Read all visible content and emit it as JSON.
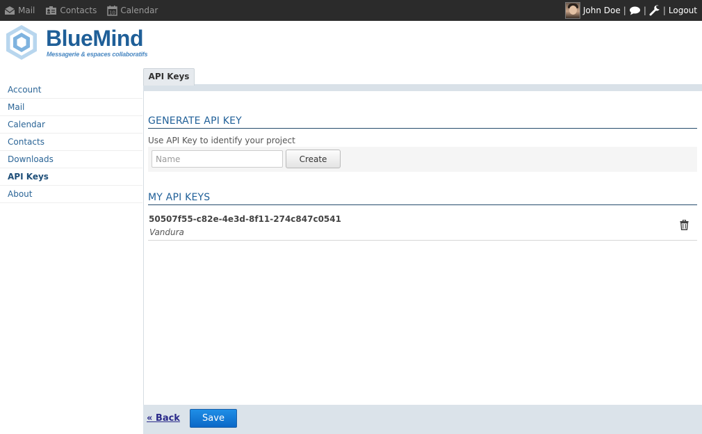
{
  "topbar": {
    "nav": [
      {
        "label": "Mail",
        "icon": "mail-icon"
      },
      {
        "label": "Contacts",
        "icon": "contacts-icon"
      },
      {
        "label": "Calendar",
        "icon": "calendar-icon"
      }
    ],
    "user_name": "John Doe",
    "separator": "|",
    "logout_label": "Logout"
  },
  "logo": {
    "title": "BlueMind",
    "subtitle": "Messagerie & espaces collaboratifs"
  },
  "sidebar": {
    "items": [
      {
        "label": "Account"
      },
      {
        "label": "Mail"
      },
      {
        "label": "Calendar"
      },
      {
        "label": "Contacts"
      },
      {
        "label": "Downloads"
      },
      {
        "label": "API Keys"
      },
      {
        "label": "About"
      }
    ],
    "active_index": 5
  },
  "tabs": [
    {
      "label": "API Keys"
    }
  ],
  "generate": {
    "title": "GENERATE API KEY",
    "description": "Use API Key to identify your project",
    "name_placeholder": "Name",
    "create_label": "Create"
  },
  "my_keys": {
    "title": "MY API KEYS",
    "keys": [
      {
        "id": "50507f55-c82e-4e3d-8f11-274c847c0541",
        "name": "Vandura"
      }
    ]
  },
  "footer": {
    "back_label": "« Back",
    "save_label": "Save"
  },
  "colors": {
    "accent": "#1f5f98",
    "topbar_bg": "#2b2b2b",
    "save_button": "#0b78dd",
    "footer_bg": "#dbe3ea"
  }
}
